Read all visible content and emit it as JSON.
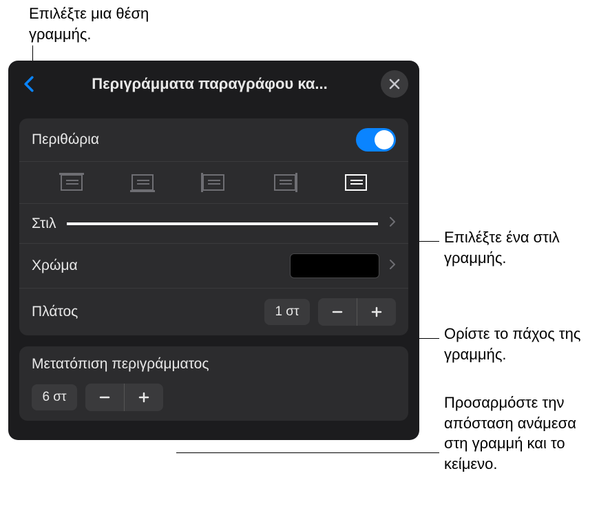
{
  "callouts": {
    "position": "Επιλέξτε μια θέση γραμμής.",
    "style": "Επιλέξτε ένα στιλ γραμμής.",
    "width": "Ορίστε το πάχος της γραμμής.",
    "offset": "Προσαρμόστε την απόσταση ανάμεσα στη γραμμή και το κείμενο."
  },
  "panel": {
    "title": "Περιγράμματα παραγράφου κα..."
  },
  "borders": {
    "label": "Περιθώρια",
    "enabled": true
  },
  "positions": {
    "selected": "all",
    "options": [
      "top",
      "bottom",
      "left",
      "right",
      "all"
    ]
  },
  "style": {
    "label": "Στιλ"
  },
  "color": {
    "label": "Χρώμα",
    "value": "#000000"
  },
  "width": {
    "label": "Πλάτος",
    "value": "1 στ"
  },
  "offset": {
    "label": "Μετατόπιση περιγράμματος",
    "value": "6 στ"
  }
}
